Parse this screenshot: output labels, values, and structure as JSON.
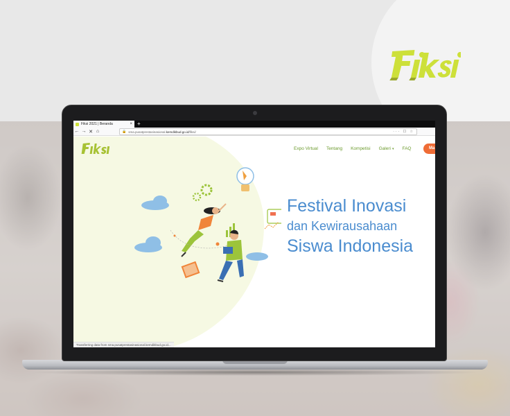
{
  "browser": {
    "tab_title": "Fiksi 2021 | Beranda",
    "tab_close": "×",
    "new_tab": "+",
    "url_prefix": "sma.pusatprestasinasional.",
    "url_domain": "kemdikbud.go.id",
    "url_path": "/fiksi/",
    "url_actions": "··· ☐ ☆",
    "status_text": "Transferring data from sma.pusatprestasinasional.kemdikbud.go.id...",
    "nav_back": "←",
    "nav_forward": "→",
    "nav_reload": "✕",
    "nav_home": "⌂"
  },
  "site": {
    "logo_text": "Fiksi",
    "nav": [
      {
        "label": "Expo Virtual"
      },
      {
        "label": "Tentang"
      },
      {
        "label": "Kompetisi"
      },
      {
        "label": "Galeri"
      },
      {
        "label": "FAQ"
      }
    ],
    "cta_label": "Ma",
    "hero": {
      "line1": "Festival Inovasi",
      "line2": "dan Kewirausahaan",
      "line3": "Siswa Indonesia"
    }
  },
  "brand": {
    "logo_text": "Fiksi"
  },
  "colors": {
    "accent_green": "#6b9a2d",
    "hero_blue": "#4a8ccf",
    "cta_orange": "#ef6c36",
    "logo_yellow": "#cde03a"
  }
}
